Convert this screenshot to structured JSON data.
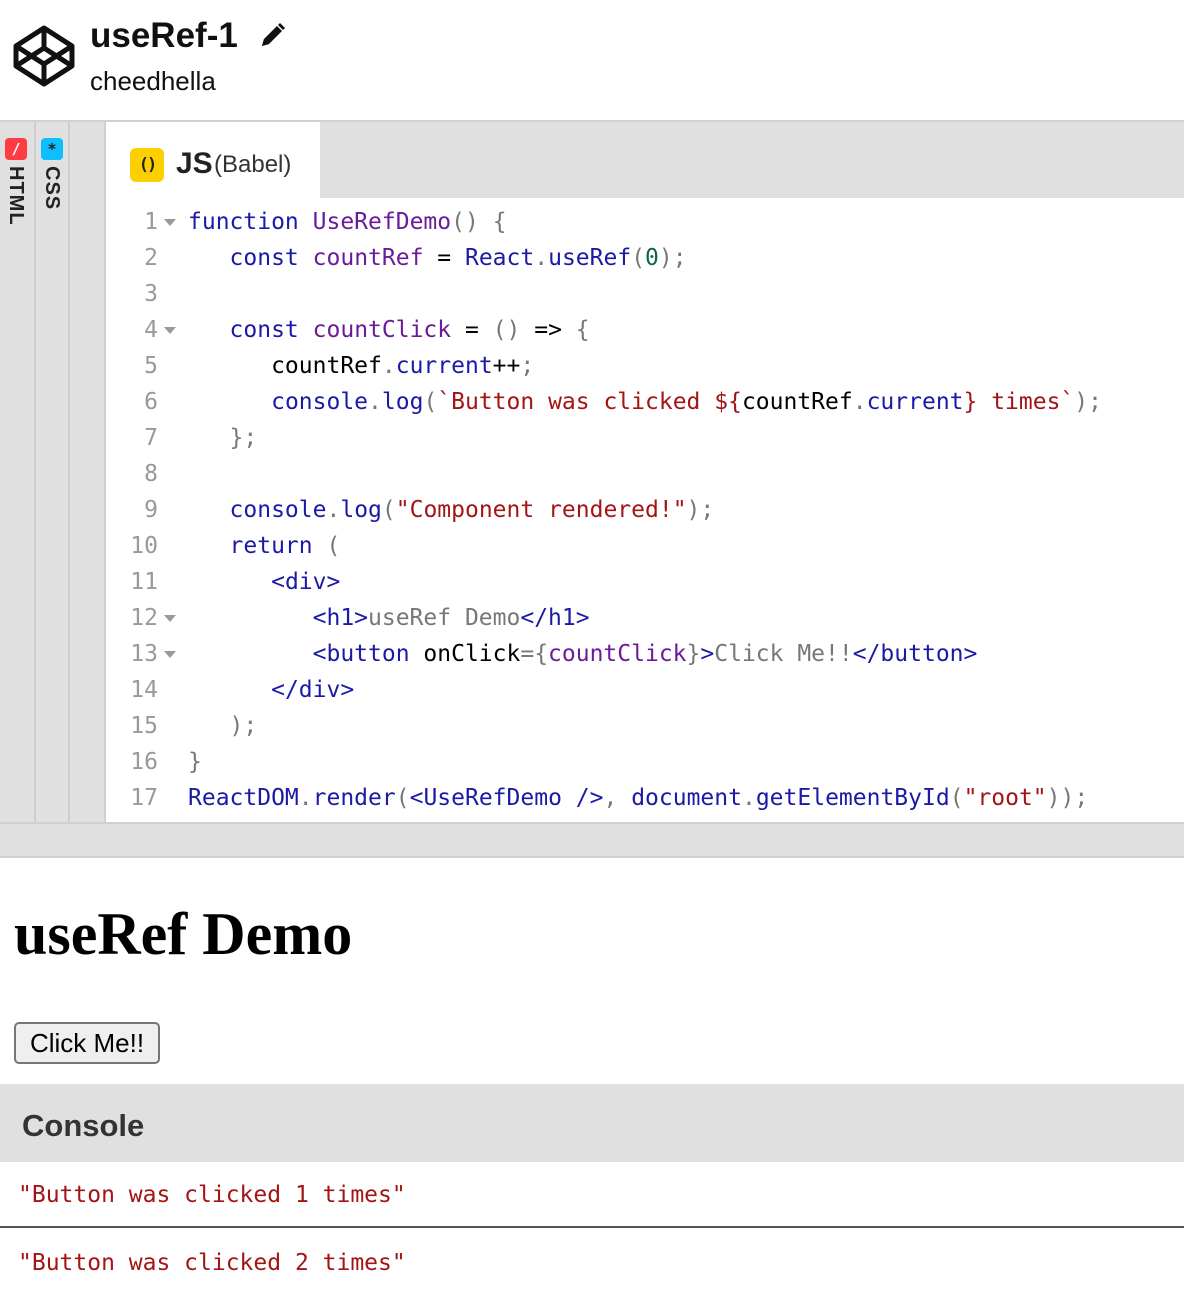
{
  "header": {
    "title": "useRef-1",
    "user": "cheedhella"
  },
  "rails": {
    "html_label": "HTML",
    "css_label": "CSS",
    "html_badge": "/",
    "css_badge": "*"
  },
  "tab": {
    "badge": "()",
    "label": "JS",
    "sublabel": "(Babel)"
  },
  "code_lines": [
    "function UseRefDemo() {",
    "   const countRef = React.useRef(0);",
    "",
    "   const countClick = () => {",
    "      countRef.current++;",
    "      console.log(`Button was clicked ${countRef.current} times`);",
    "   };",
    "",
    "   console.log(\"Component rendered!\");",
    "   return (",
    "      <div>",
    "         <h1>useRef Demo</h1>",
    "         <button onClick={countClick}>Click Me!!</button>",
    "      </div>",
    "   );",
    "}",
    "ReactDOM.render(<UseRefDemo />, document.getElementById(\"root\"));"
  ],
  "fold_lines": [
    1,
    4,
    12,
    13
  ],
  "output": {
    "heading": "useRef Demo",
    "button": "Click Me!!"
  },
  "console": {
    "title": "Console",
    "logs": [
      "\"Button was clicked 1 times\"",
      "\"Button was clicked 2 times\""
    ]
  }
}
